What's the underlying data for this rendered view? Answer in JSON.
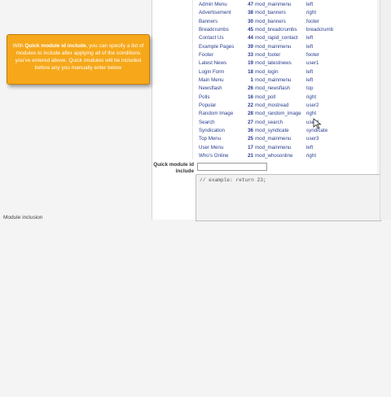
{
  "modules": [
    {
      "name": "Admin Menu",
      "id": "47",
      "module": "mod_mainmenu",
      "position": "left"
    },
    {
      "name": "Advertisement",
      "id": "38",
      "module": "mod_banners",
      "position": "right"
    },
    {
      "name": "Banners",
      "id": "30",
      "module": "mod_banners",
      "position": "footer"
    },
    {
      "name": "Breadcrumbs",
      "id": "45",
      "module": "mod_breadcrumbs",
      "position": "breadcrumb"
    },
    {
      "name": "Contact Us",
      "id": "44",
      "module": "mod_rapid_contact",
      "position": "left"
    },
    {
      "name": "Example Pages",
      "id": "39",
      "module": "mod_mainmenu",
      "position": "left"
    },
    {
      "name": "Footer",
      "id": "33",
      "module": "mod_footer",
      "position": "footer"
    },
    {
      "name": "Latest News",
      "id": "19",
      "module": "mod_latestnews",
      "position": "user1"
    },
    {
      "name": "Login Form",
      "id": "18",
      "module": "mod_login",
      "position": "left"
    },
    {
      "name": "Main Menu",
      "id": "1",
      "module": "mod_mainmenu",
      "position": "left"
    },
    {
      "name": "Newsflash",
      "id": "26",
      "module": "mod_newsflash",
      "position": "top"
    },
    {
      "name": "Polls",
      "id": "16",
      "module": "mod_poll",
      "position": "right"
    },
    {
      "name": "Popular",
      "id": "22",
      "module": "mod_mostread",
      "position": "user2"
    },
    {
      "name": "Random Image",
      "id": "28",
      "module": "mod_random_image",
      "position": "right"
    },
    {
      "name": "Search",
      "id": "27",
      "module": "mod_search",
      "position": "user4"
    },
    {
      "name": "Syndication",
      "id": "36",
      "module": "mod_syndicate",
      "position": "syndicate"
    },
    {
      "name": "Top Menu",
      "id": "25",
      "module": "mod_mainmenu",
      "position": "user3"
    },
    {
      "name": "User Menu",
      "id": "17",
      "module": "mod_mainmenu",
      "position": "left"
    },
    {
      "name": "Who's Online",
      "id": "21",
      "module": "mod_whosonline",
      "position": "right"
    }
  ],
  "quick_module": {
    "label": "Quick module id include",
    "value": ""
  },
  "code_editor": {
    "text": "// example: return 23;"
  },
  "tooltip": {
    "prefix": "With ",
    "bold": "Quick module id include",
    "rest": ", you can specify a list of modules to include after applying all of the conditions you've entered above. Quick modules will be included before any you manually enter below"
  },
  "bottom_fragment": "Module inclusion",
  "colors": {
    "tooltip_bg": "#f6a81a",
    "link_text": "#2a3f8f"
  }
}
